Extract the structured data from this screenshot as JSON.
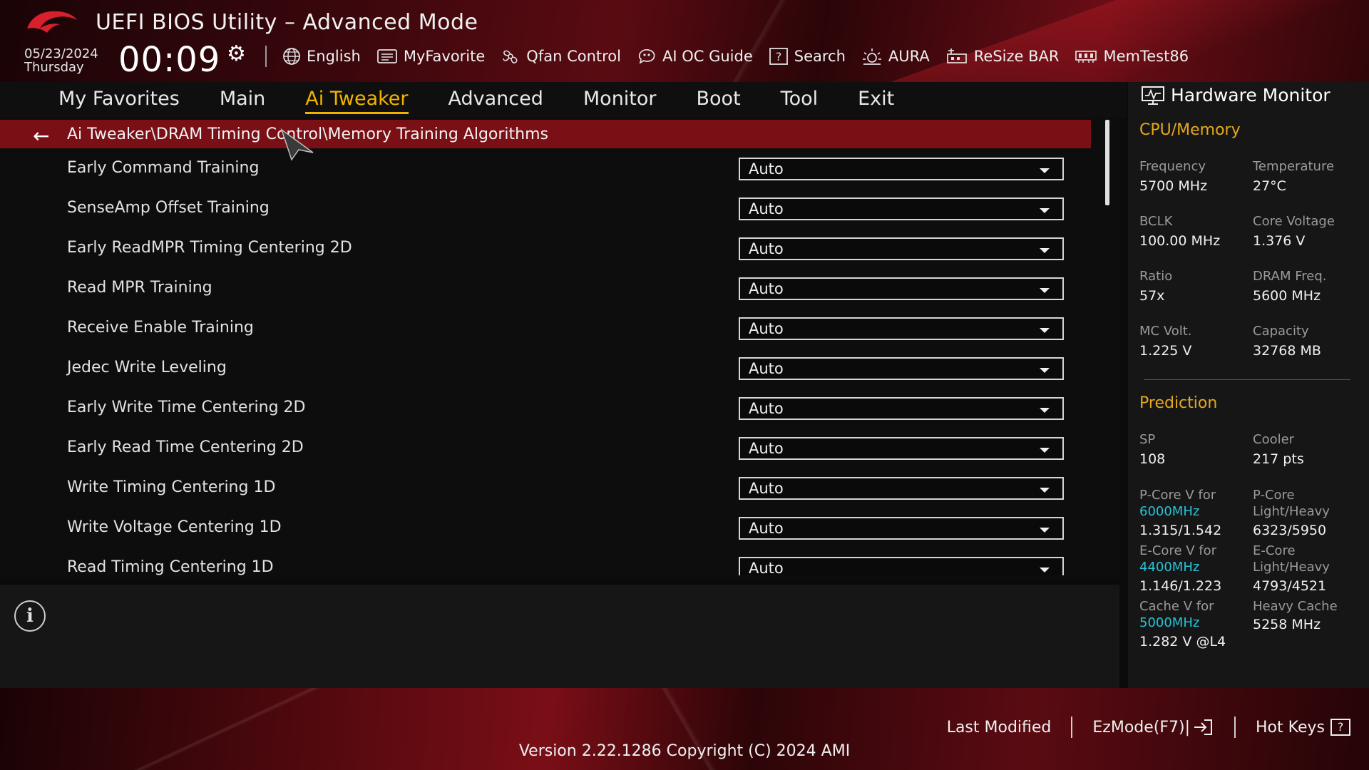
{
  "header": {
    "title": "UEFI BIOS Utility – Advanced Mode",
    "date": "05/23/2024",
    "weekday": "Thursday",
    "time": "00:09",
    "toolbar": [
      {
        "label": "English",
        "icon": "globe-icon"
      },
      {
        "label": "MyFavorite",
        "icon": "favorite-icon"
      },
      {
        "label": "Qfan Control",
        "icon": "fan-icon"
      },
      {
        "label": "AI OC Guide",
        "icon": "ai-guide-icon"
      },
      {
        "label": "Search",
        "icon": "search-icon"
      },
      {
        "label": "AURA",
        "icon": "aura-icon"
      },
      {
        "label": "ReSize BAR",
        "icon": "resize-bar-icon"
      },
      {
        "label": "MemTest86",
        "icon": "memtest-icon"
      }
    ]
  },
  "tabs": [
    {
      "label": "My Favorites"
    },
    {
      "label": "Main"
    },
    {
      "label": "Ai Tweaker",
      "active": true
    },
    {
      "label": "Advanced"
    },
    {
      "label": "Monitor"
    },
    {
      "label": "Boot"
    },
    {
      "label": "Tool"
    },
    {
      "label": "Exit"
    }
  ],
  "breadcrumb": "Ai Tweaker\\DRAM Timing Control\\Memory Training Algorithms",
  "settings": [
    {
      "label": "Early Command Training",
      "value": "Auto"
    },
    {
      "label": "SenseAmp Offset Training",
      "value": "Auto"
    },
    {
      "label": "Early ReadMPR Timing Centering 2D",
      "value": "Auto"
    },
    {
      "label": "Read MPR Training",
      "value": "Auto"
    },
    {
      "label": "Receive Enable Training",
      "value": "Auto"
    },
    {
      "label": "Jedec Write Leveling",
      "value": "Auto"
    },
    {
      "label": "Early Write Time Centering 2D",
      "value": "Auto"
    },
    {
      "label": "Early Read Time Centering 2D",
      "value": "Auto"
    },
    {
      "label": "Write Timing Centering 1D",
      "value": "Auto"
    },
    {
      "label": "Write Voltage Centering 1D",
      "value": "Auto"
    },
    {
      "label": "Read Timing Centering 1D",
      "value": "Auto"
    }
  ],
  "hardware_monitor": {
    "title": "Hardware Monitor",
    "cpu_memory": {
      "heading": "CPU/Memory",
      "frequency_label": "Frequency",
      "frequency": "5700 MHz",
      "temperature_label": "Temperature",
      "temperature": "27°C",
      "bclk_label": "BCLK",
      "bclk": "100.00 MHz",
      "core_voltage_label": "Core Voltage",
      "core_voltage": "1.376 V",
      "ratio_label": "Ratio",
      "ratio": "57x",
      "dram_freq_label": "DRAM Freq.",
      "dram_freq": "5600 MHz",
      "mc_volt_label": "MC Volt.",
      "mc_volt": "1.225 V",
      "capacity_label": "Capacity",
      "capacity": "32768 MB"
    },
    "prediction": {
      "heading": "Prediction",
      "sp_label": "SP",
      "sp": "108",
      "cooler_label": "Cooler",
      "cooler": "217 pts",
      "pcore_v_label": "P-Core V for",
      "pcore_v_freq": "6000MHz",
      "pcore_v": "1.315/1.542",
      "pcore_lh_label_1": "P-Core",
      "pcore_lh_label_2": "Light/Heavy",
      "pcore_lh": "6323/5950",
      "ecore_v_label": "E-Core V for",
      "ecore_v_freq": "4400MHz",
      "ecore_v": "1.146/1.223",
      "ecore_lh_label_1": "E-Core",
      "ecore_lh_label_2": "Light/Heavy",
      "ecore_lh": "4793/4521",
      "cache_v_label": "Cache V for",
      "cache_v_freq": "5000MHz",
      "cache_v": "1.282 V @L4",
      "heavy_cache_label": "Heavy Cache",
      "heavy_cache": "5258 MHz"
    }
  },
  "footer": {
    "last_modified": "Last Modified",
    "ezmode": "EzMode(F7)|",
    "hotkeys": "Hot Keys",
    "hotkeys_key": "?",
    "version": "Version 2.22.1286 Copyright (C) 2024 AMI"
  },
  "colors": {
    "accent_active_tab": "#f0b400",
    "breadcrumb_bg": "#7a1015",
    "section_heading": "#e5a81a",
    "frequency_highlight": "#27c3d6"
  }
}
